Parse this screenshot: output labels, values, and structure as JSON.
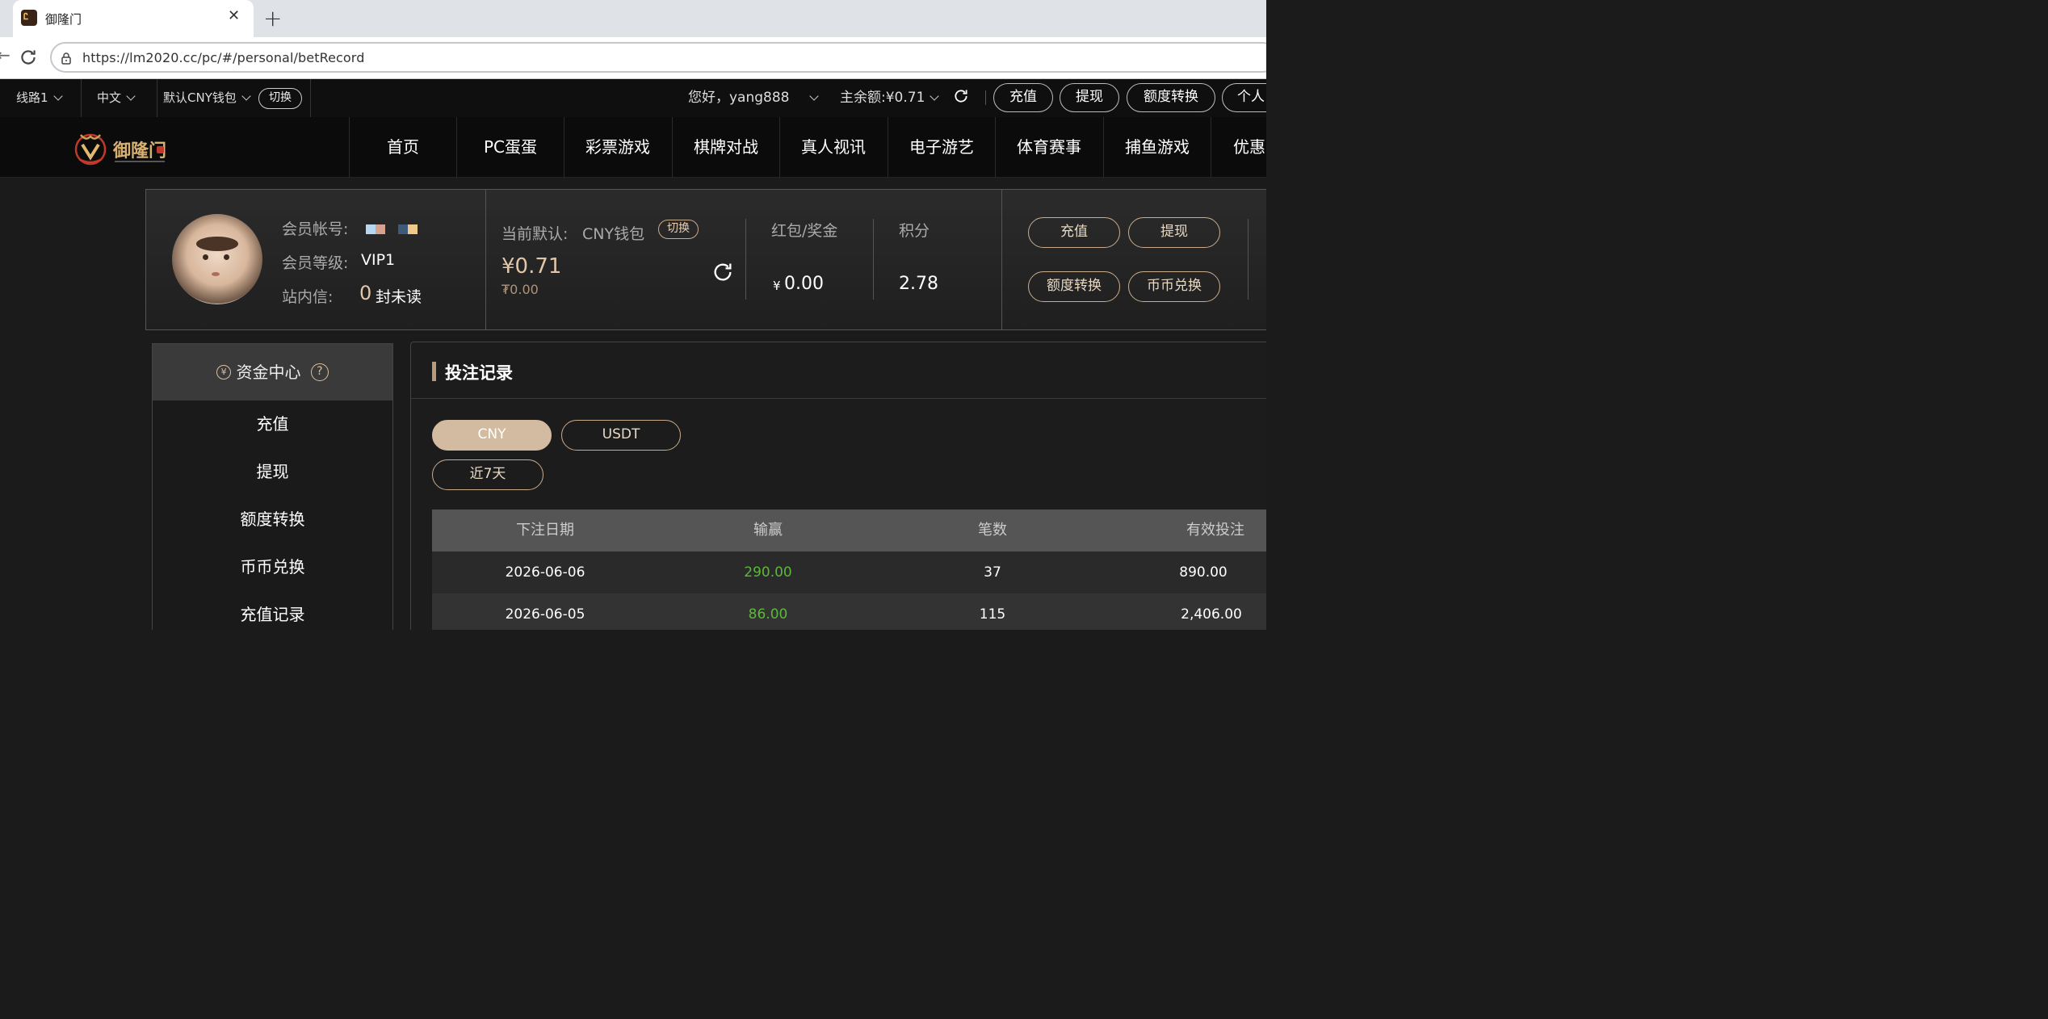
{
  "browser": {
    "tab_title": "御隆门",
    "url": "https://lm2020.cc/pc/#/personal/betRecord"
  },
  "topbar": {
    "line_select": "线路1",
    "language_select": "中文",
    "wallet_select": "默认CNY钱包",
    "switch_label": "切换",
    "greeting": "您好，yang888",
    "balance_label": "主余额:",
    "balance_value": "¥0.71",
    "buttons": [
      "充值",
      "提现",
      "额度转换",
      "个人"
    ]
  },
  "nav": {
    "logo_text": "御隆门",
    "items": [
      "首页",
      "PC蛋蛋",
      "彩票游戏",
      "棋牌对战",
      "真人视讯",
      "电子游艺",
      "体育赛事",
      "捕鱼游戏",
      "优惠"
    ]
  },
  "profile": {
    "account_label": "会员帐号:",
    "level_label": "会员等级:",
    "level_value": "VIP1",
    "inbox_label": "站内信:",
    "inbox_count": "0",
    "inbox_unit": "封未读",
    "wallet_label": "当前默认:",
    "wallet_name": "CNY钱包",
    "wallet_switch": "切换",
    "wallet_balance": "¥0.71",
    "wallet_sub": "₮0.00",
    "bonus_label": "红包/奖金",
    "bonus_currency": "¥",
    "bonus_value": "0.00",
    "points_label": "积分",
    "points_value": "2.78",
    "actions": [
      "充值",
      "提现",
      "额度转换",
      "币币兑换"
    ]
  },
  "sidebar": {
    "heading": "资金中心",
    "items": [
      "充值",
      "提现",
      "额度转换",
      "币币兑换",
      "充值记录"
    ]
  },
  "content": {
    "title": "投注记录",
    "currency_tabs": [
      "CNY",
      "USDT"
    ],
    "active_currency": "CNY",
    "period": "近7天",
    "table": {
      "headers": [
        "下注日期",
        "输赢",
        "笔数",
        "有效投注"
      ],
      "rows": [
        [
          "2026-06-06",
          "290.00",
          "37",
          "890.00"
        ],
        [
          "2026-06-05",
          "86.00",
          "115",
          "2,406.00"
        ]
      ]
    }
  },
  "colors": {
    "accent_gold": "#c8ac8c",
    "win_green": "#5cb83a",
    "active_tab_bg": "#d2bba0"
  }
}
